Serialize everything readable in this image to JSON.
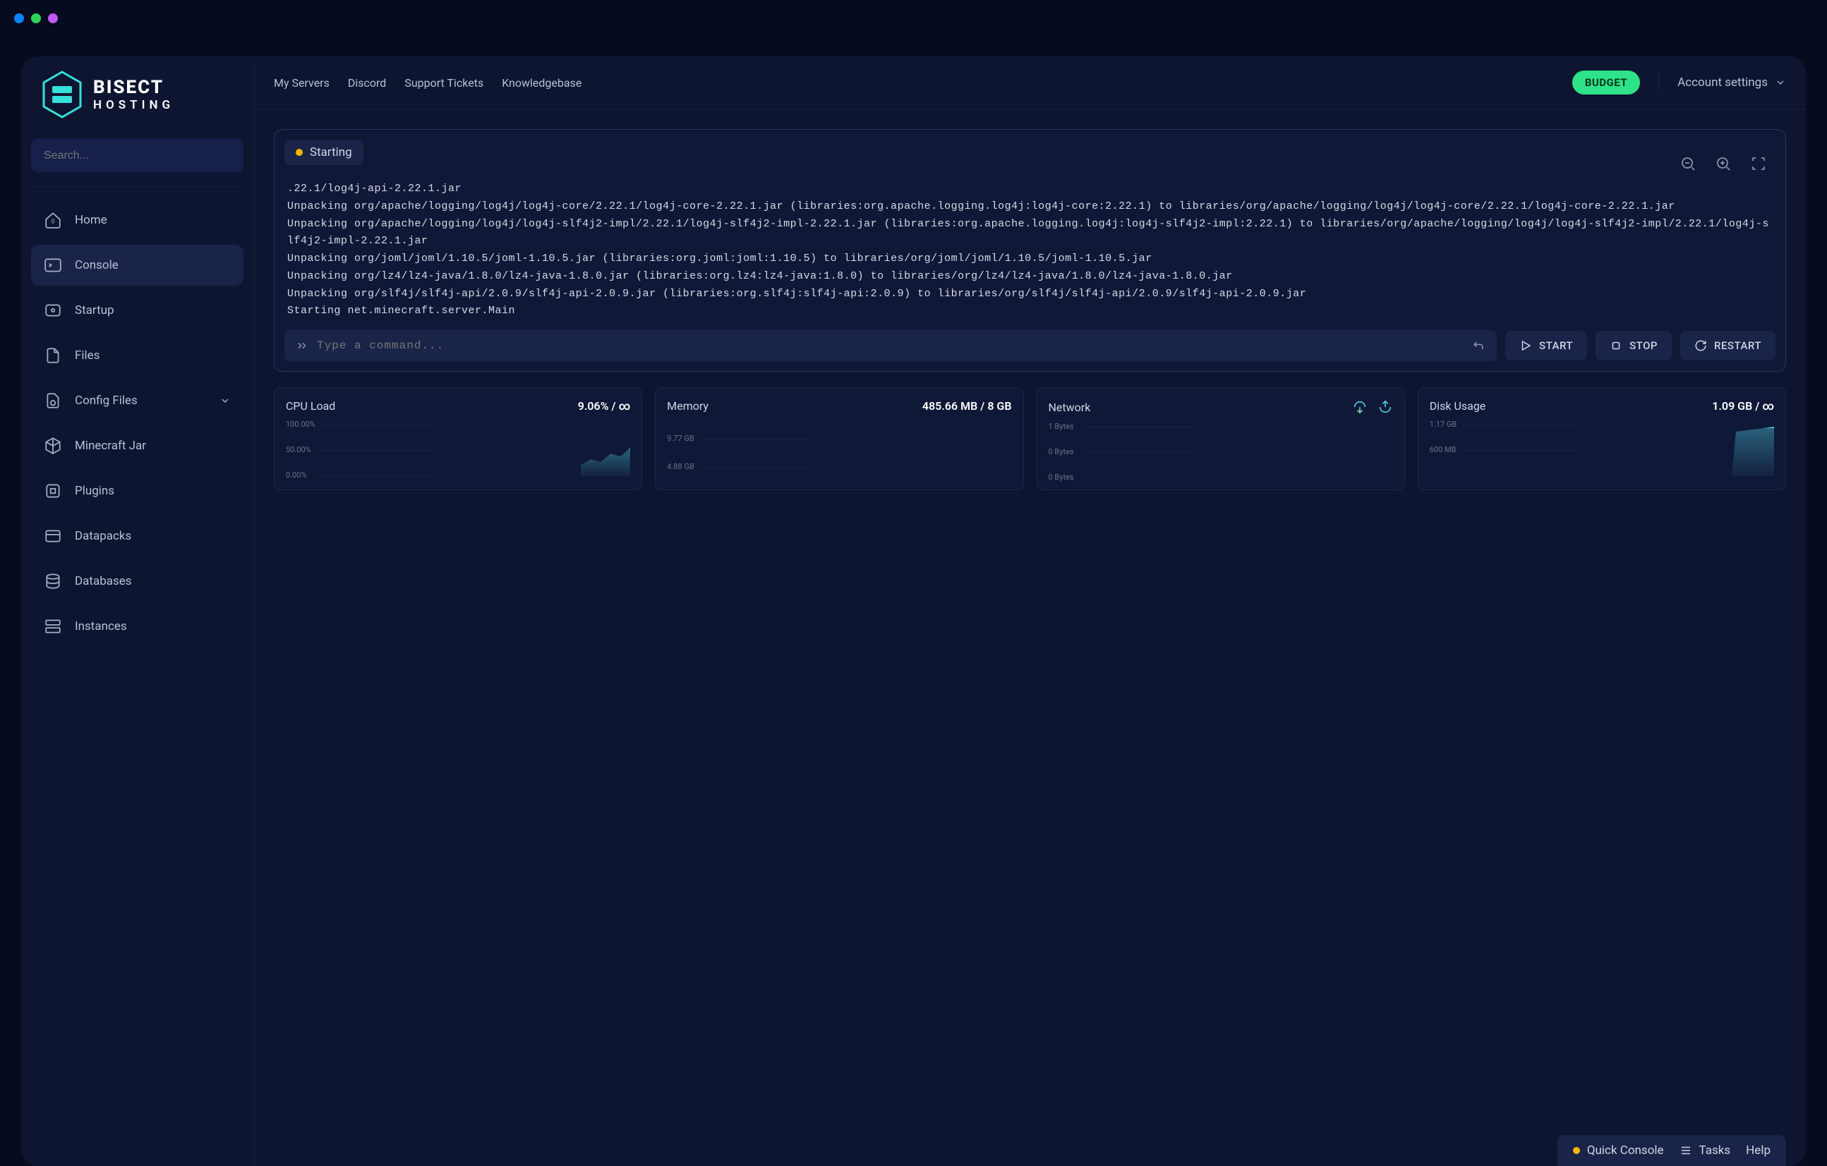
{
  "titlebar": {},
  "logo": {
    "line1": "BISECT",
    "line2": "HOSTING"
  },
  "search": {
    "placeholder": "Search..."
  },
  "nav": {
    "items": [
      {
        "label": "Home"
      },
      {
        "label": "Console"
      },
      {
        "label": "Startup"
      },
      {
        "label": "Files"
      },
      {
        "label": "Config Files"
      },
      {
        "label": "Minecraft Jar"
      },
      {
        "label": "Plugins"
      },
      {
        "label": "Datapacks"
      },
      {
        "label": "Databases"
      },
      {
        "label": "Instances"
      }
    ]
  },
  "topbar": {
    "links": [
      "My Servers",
      "Discord",
      "Support Tickets",
      "Knowledgebase"
    ],
    "budget": "BUDGET",
    "account": "Account settings"
  },
  "console": {
    "status": "Starting",
    "log": ".22.1/log4j-api-2.22.1.jar\nUnpacking org/apache/logging/log4j/log4j-core/2.22.1/log4j-core-2.22.1.jar (libraries:org.apache.logging.log4j:log4j-core:2.22.1) to libraries/org/apache/logging/log4j/log4j-core/2.22.1/log4j-core-2.22.1.jar\nUnpacking org/apache/logging/log4j/log4j-slf4j2-impl/2.22.1/log4j-slf4j2-impl-2.22.1.jar (libraries:org.apache.logging.log4j:log4j-slf4j2-impl:2.22.1) to libraries/org/apache/logging/log4j/log4j-slf4j2-impl/2.22.1/log4j-slf4j2-impl-2.22.1.jar\nUnpacking org/joml/joml/1.10.5/joml-1.10.5.jar (libraries:org.joml:joml:1.10.5) to libraries/org/joml/joml/1.10.5/joml-1.10.5.jar\nUnpacking org/lz4/lz4-java/1.8.0/lz4-java-1.8.0.jar (libraries:org.lz4:lz4-java:1.8.0) to libraries/org/lz4/lz4-java/1.8.0/lz4-java-1.8.0.jar\nUnpacking org/slf4j/slf4j-api/2.0.9/slf4j-api-2.0.9.jar (libraries:org.slf4j:slf4j-api:2.0.9) to libraries/org/slf4j/slf4j-api/2.0.9/slf4j-api-2.0.9.jar\nStarting net.minecraft.server.Main",
    "cmd_placeholder": "Type a command...",
    "start": "START",
    "stop": "STOP",
    "restart": "RESTART"
  },
  "stats": {
    "cpu": {
      "label": "CPU Load",
      "value": "9.06% / ∞",
      "ticks": [
        "100.00%",
        "50.00%",
        "0.00%"
      ]
    },
    "memory": {
      "label": "Memory",
      "value": "485.66 MB / 8 GB",
      "ticks": [
        "9.77 GB",
        "4.88 GB"
      ]
    },
    "network": {
      "label": "Network",
      "ticks": [
        "1 Bytes",
        "0 Bytes",
        "0 Bytes"
      ]
    },
    "disk": {
      "label": "Disk Usage",
      "value": "1.09 GB / ∞",
      "ticks": [
        "1.17 GB",
        "600 MB"
      ]
    }
  },
  "bottom": {
    "quick_console": "Quick Console",
    "tasks": "Tasks",
    "help": "Help"
  },
  "chart_data": [
    {
      "type": "area",
      "title": "CPU Load",
      "ylabel": "%",
      "ylim": [
        0,
        100
      ],
      "values": [
        0,
        0,
        0,
        2,
        4,
        9,
        8,
        12,
        9
      ]
    },
    {
      "type": "area",
      "title": "Memory",
      "ylabel": "GB",
      "ylim": [
        0,
        9.77
      ],
      "values": [
        0,
        0,
        0,
        0,
        0,
        0.2,
        0.3,
        0.48
      ]
    },
    {
      "type": "area",
      "title": "Network",
      "ylabel": "Bytes",
      "ylim": [
        0,
        1
      ],
      "values": [
        0,
        0,
        0,
        0,
        0,
        0,
        0
      ]
    },
    {
      "type": "area",
      "title": "Disk Usage",
      "ylabel": "GB",
      "ylim": [
        0,
        1.17
      ],
      "values": [
        0,
        0,
        0,
        0,
        1.0,
        1.09,
        1.09
      ]
    }
  ]
}
